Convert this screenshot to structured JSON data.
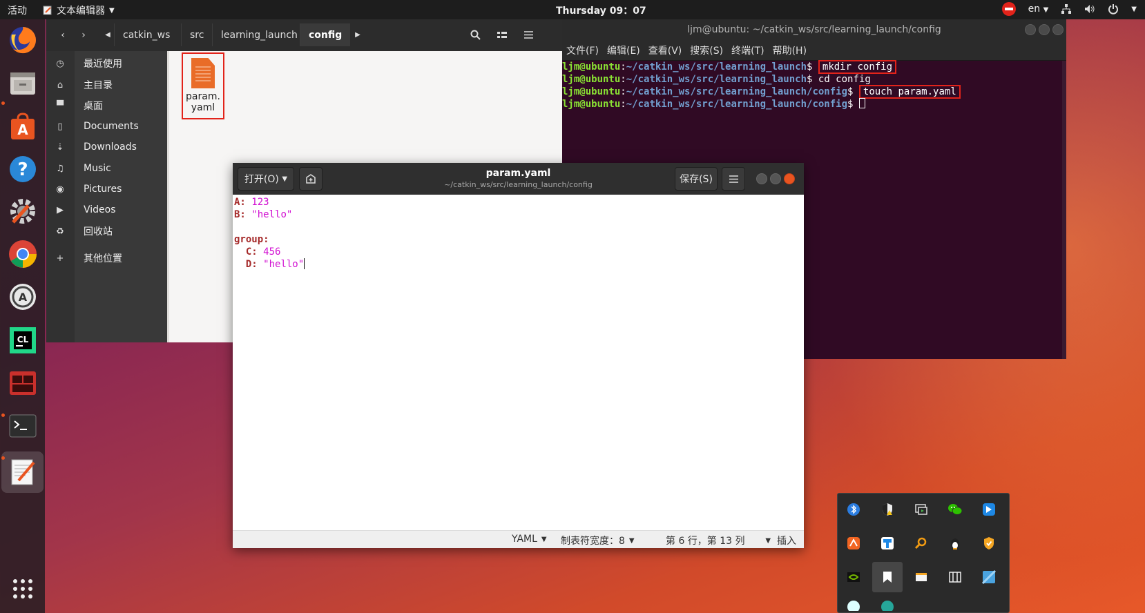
{
  "topbar": {
    "activities": "活动",
    "app_name": "文本编辑器",
    "clock": "Thursday 09：07",
    "language": "en"
  },
  "dock": {
    "items": [
      "firefox-icon",
      "files-icon",
      "software-center-icon",
      "help-icon",
      "settings-icon",
      "chrome-icon",
      "updater-icon",
      "clion-icon",
      "terminal-alt-icon",
      "terminal-icon",
      "text-editor-icon",
      "show-apps-icon"
    ]
  },
  "files": {
    "breadcrumbs": [
      "catkin_ws",
      "src",
      "learning_launch",
      "config"
    ],
    "sidebar": [
      {
        "icon": "recent-icon",
        "label": "最近使用"
      },
      {
        "icon": "home-icon",
        "label": "主目录"
      },
      {
        "icon": "desktop-icon",
        "label": "桌面"
      },
      {
        "icon": "documents-icon",
        "label": "Documents"
      },
      {
        "icon": "downloads-icon",
        "label": "Downloads"
      },
      {
        "icon": "music-icon",
        "label": "Music"
      },
      {
        "icon": "pictures-icon",
        "label": "Pictures"
      },
      {
        "icon": "videos-icon",
        "label": "Videos"
      },
      {
        "icon": "trash-icon",
        "label": "回收站"
      },
      {
        "icon": "add-icon",
        "label": "其他位置"
      }
    ],
    "file": {
      "name_line1": "param.",
      "name_line2": "yaml"
    }
  },
  "terminal": {
    "title": "ljm@ubuntu: ~/catkin_ws/src/learning_launch/config",
    "menu": [
      "文件(F)",
      "编辑(E)",
      "查看(V)",
      "搜索(S)",
      "终端(T)",
      "帮助(H)"
    ],
    "prompt_user": "ljm@ubuntu",
    "lines": [
      {
        "path": "~/catkin_ws/src/learning_launch",
        "cmd": "mkdir config"
      },
      {
        "path": "~/catkin_ws/src/learning_launch",
        "cmd": "cd config"
      },
      {
        "path": "~/catkin_ws/src/learning_launch/config",
        "cmd": "touch param.yaml"
      },
      {
        "path": "~/catkin_ws/src/learning_launch/config",
        "cmd": ""
      }
    ]
  },
  "gedit": {
    "open_label": "打开(O)",
    "save_label": "保存(S)",
    "title": "param.yaml",
    "subtitle": "~/catkin_ws/src/learning_launch/config",
    "content": {
      "a_key": "A:",
      "a_val": "123",
      "b_key": "B:",
      "b_val": "\"hello\"",
      "group_key": "group:",
      "c_key": "C:",
      "c_val": "456",
      "d_key": "D:",
      "d_val": "\"hello\""
    },
    "status": {
      "language": "YAML",
      "tab_width": "制表符宽度：8",
      "position": "第 6 行，第 13 列",
      "mode": "插入"
    }
  },
  "tray_popup": {
    "icons": [
      "bluetooth-icon",
      "security-warning-icon",
      "screencast-icon",
      "wechat-icon",
      "feishu-icon",
      "huawei-icon",
      "blue-app-icon",
      "search-app-icon",
      "penguin-icon",
      "shield-icon",
      "nvidia-icon",
      "bookmark-icon",
      "window-icon",
      "panel-icon",
      "blue-square-icon"
    ]
  }
}
